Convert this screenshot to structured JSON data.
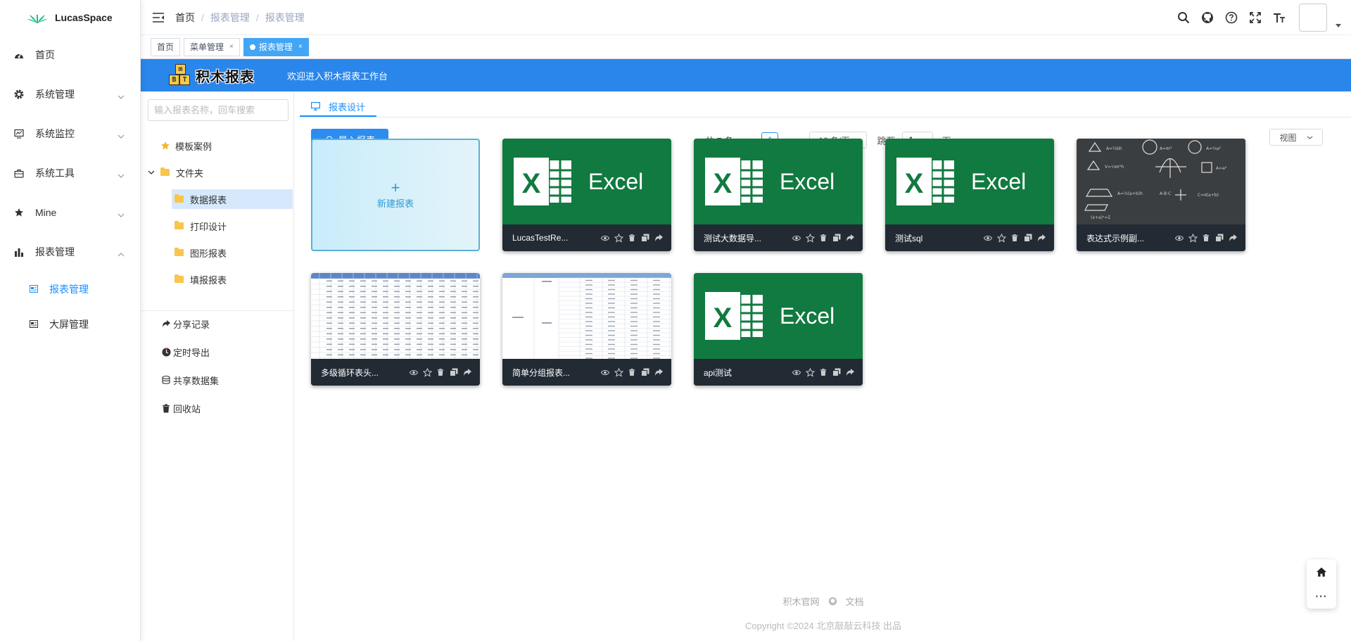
{
  "app": {
    "name": "LucasSpace"
  },
  "sidebar": {
    "items": [
      {
        "label": "首页",
        "icon": "dashboard-icon"
      },
      {
        "label": "系统管理",
        "icon": "gear-icon"
      },
      {
        "label": "系统监控",
        "icon": "monitor-icon"
      },
      {
        "label": "系统工具",
        "icon": "toolbox-icon"
      },
      {
        "label": "Mine",
        "icon": "star-icon"
      },
      {
        "label": "报表管理",
        "icon": "bar-chart-icon"
      }
    ],
    "subitems": [
      {
        "label": "报表管理",
        "active": true
      },
      {
        "label": "大屏管理",
        "active": false
      }
    ]
  },
  "breadcrumb": [
    "首页",
    "报表管理",
    "报表管理"
  ],
  "tags": [
    {
      "label": "首页",
      "closable": false,
      "active": false
    },
    {
      "label": "菜单管理",
      "closable": true,
      "active": false
    },
    {
      "label": "报表管理",
      "closable": true,
      "active": true
    }
  ],
  "banner": {
    "logo_text": "积木报表",
    "welcome": "欢迎进入积木报表工作台",
    "blocks": [
      "m",
      "B",
      "T"
    ]
  },
  "tree": {
    "search_placeholder": "输入报表名称，回车搜索",
    "template": "模板案例",
    "folder": "文件夹",
    "children": [
      "数据报表",
      "打印设计",
      "图形报表",
      "填报报表"
    ],
    "selected_index": 0,
    "links": [
      {
        "label": "分享记录",
        "icon": "share-icon"
      },
      {
        "label": "定时导出",
        "icon": "clock-icon"
      },
      {
        "label": "共享数据集",
        "icon": "database-icon"
      },
      {
        "label": "回收站",
        "icon": "trash-icon"
      }
    ]
  },
  "main": {
    "tab_label": "报表设计",
    "import_label": "导入报表",
    "pager": {
      "total": "共 7 条",
      "current": "1",
      "page_size": "10 条/页",
      "goto_label": "跳至",
      "goto_value": "1",
      "goto_suffix": "页"
    },
    "view_label": "视图",
    "new_card_label": "新建报表",
    "cards": [
      {
        "name": "LucasTestRe...",
        "thumb": "excel"
      },
      {
        "name": "测试大数据导...",
        "thumb": "excel"
      },
      {
        "name": "测试sql",
        "thumb": "excel"
      },
      {
        "name": "表达式示例副...",
        "thumb": "board"
      },
      {
        "name": "多级循环表头...",
        "thumb": "sheet"
      },
      {
        "name": "简单分组报表...",
        "thumb": "sheet2"
      },
      {
        "name": "api测试",
        "thumb": "excel"
      }
    ],
    "excel_word": "Excel"
  },
  "footer": {
    "link1": "积木官网",
    "link2": "文档",
    "copyright": "Copyright ©2024 北京敲敲云科技 出品"
  },
  "colors": {
    "primary": "#1890ff",
    "banner": "#2a86ea",
    "excel_green": "#117a40"
  }
}
